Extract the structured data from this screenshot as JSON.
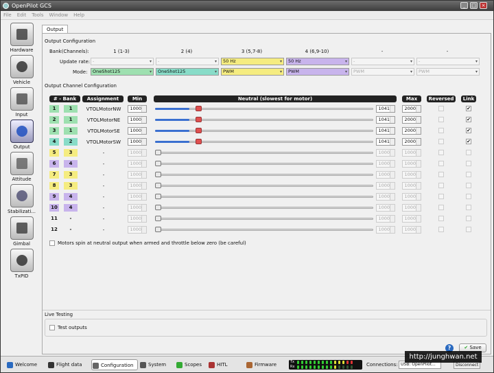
{
  "window": {
    "title": "OpenPilot GCS"
  },
  "menu": [
    "File",
    "Edit",
    "Tools",
    "Window",
    "Help"
  ],
  "sidebar": [
    {
      "label": "Hardware"
    },
    {
      "label": "Vehicle"
    },
    {
      "label": "Input"
    },
    {
      "label": "Output"
    },
    {
      "label": "Attitude"
    },
    {
      "label": "Stabilizati..."
    },
    {
      "label": "Gimbal"
    },
    {
      "label": "TxPID"
    }
  ],
  "tab": "Output",
  "output_config": {
    "title": "Output Configuration",
    "bank_label": "Bank(Channels):",
    "update_label": "Update rate:",
    "mode_label": "Mode:",
    "banks": [
      {
        "name": "1 (1-3)",
        "rate": "-",
        "mode": "OneShot125",
        "color": "#9ee0b0",
        "enabled": true
      },
      {
        "name": "2 (4)",
        "rate": "-",
        "mode": "OneShot125",
        "color": "#88dcc8",
        "enabled": true
      },
      {
        "name": "3 (5,7-8)",
        "rate": "50 Hz",
        "mode": "PWM",
        "color": "#f5ec80",
        "enabled": true
      },
      {
        "name": "4 (6,9-10)",
        "rate": "50 Hz",
        "mode": "PWM",
        "color": "#c8b4ec",
        "enabled": true
      },
      {
        "name": "-",
        "rate": "-",
        "mode": "PWM",
        "color": "",
        "enabled": false
      },
      {
        "name": "-",
        "rate": "-",
        "mode": "PWM",
        "color": "",
        "enabled": false
      }
    ]
  },
  "channel_config": {
    "title": "Output Channel Configuration",
    "headers": {
      "bank": "# - Bank",
      "assignment": "Assignment",
      "min": "Min",
      "neutral": "Neutral (slowest for motor)",
      "max": "Max",
      "reversed": "Reversed",
      "link": "Link"
    },
    "rows": [
      {
        "num": "1",
        "bank": "1",
        "assign": "VTOLMotorNW",
        "min": "1000",
        "neutral": "1041",
        "max": "2000",
        "level": 0.041,
        "link": true,
        "active": true,
        "color": "#9ee0b0"
      },
      {
        "num": "2",
        "bank": "1",
        "assign": "VTOLMotorNE",
        "min": "1000",
        "neutral": "1041",
        "max": "2000",
        "level": 0.041,
        "link": true,
        "active": true,
        "color": "#9ee0b0"
      },
      {
        "num": "3",
        "bank": "1",
        "assign": "VTOLMotorSE",
        "min": "1000",
        "neutral": "1041",
        "max": "2000",
        "level": 0.041,
        "link": true,
        "active": true,
        "color": "#9ee0b0"
      },
      {
        "num": "4",
        "bank": "2",
        "assign": "VTOLMotorSW",
        "min": "1000",
        "neutral": "1041",
        "max": "2000",
        "level": 0.041,
        "link": true,
        "active": true,
        "color": "#88dcc8"
      },
      {
        "num": "5",
        "bank": "3",
        "assign": "-",
        "min": "1000",
        "neutral": "1000",
        "max": "1000",
        "level": 0,
        "link": false,
        "active": false,
        "color": "#f5ec80"
      },
      {
        "num": "6",
        "bank": "4",
        "assign": "-",
        "min": "1000",
        "neutral": "1000",
        "max": "1000",
        "level": 0,
        "link": false,
        "active": false,
        "color": "#c8b4ec"
      },
      {
        "num": "7",
        "bank": "3",
        "assign": "-",
        "min": "1000",
        "neutral": "1000",
        "max": "1000",
        "level": 0,
        "link": false,
        "active": false,
        "color": "#f5ec80"
      },
      {
        "num": "8",
        "bank": "3",
        "assign": "-",
        "min": "1000",
        "neutral": "1000",
        "max": "1000",
        "level": 0,
        "link": false,
        "active": false,
        "color": "#f5ec80"
      },
      {
        "num": "9",
        "bank": "4",
        "assign": "-",
        "min": "1000",
        "neutral": "1000",
        "max": "1000",
        "level": 0,
        "link": false,
        "active": false,
        "color": "#c8b4ec"
      },
      {
        "num": "10",
        "bank": "4",
        "assign": "-",
        "min": "1000",
        "neutral": "1000",
        "max": "1000",
        "level": 0,
        "link": false,
        "active": false,
        "color": "#c8b4ec"
      },
      {
        "num": "11",
        "bank": "-",
        "assign": "-",
        "min": "1000",
        "neutral": "1000",
        "max": "1000",
        "level": 0,
        "link": false,
        "active": false,
        "color": ""
      },
      {
        "num": "12",
        "bank": "-",
        "assign": "-",
        "min": "1000",
        "neutral": "1000",
        "max": "1000",
        "level": 0,
        "link": false,
        "active": false,
        "color": ""
      }
    ],
    "spin_option": "Motors spin at neutral output when armed and throttle below zero (be careful)"
  },
  "live_testing": {
    "title": "Live Testing",
    "test_outputs": "Test outputs"
  },
  "save_label": "Save",
  "help_label": "?",
  "bottom_tabs": [
    "Welcome",
    "Flight data",
    "Configuration",
    "System",
    "Scopes",
    "HITL",
    "Firmware"
  ],
  "active_tab": "Configuration",
  "txrx": {
    "tx": "Tx",
    "rx": "Rx"
  },
  "connections": {
    "label": "Connections:",
    "device": "USB: OpenPilot..."
  },
  "disconnect_label": "Disconnect",
  "watermark": "http://junghwan.net"
}
